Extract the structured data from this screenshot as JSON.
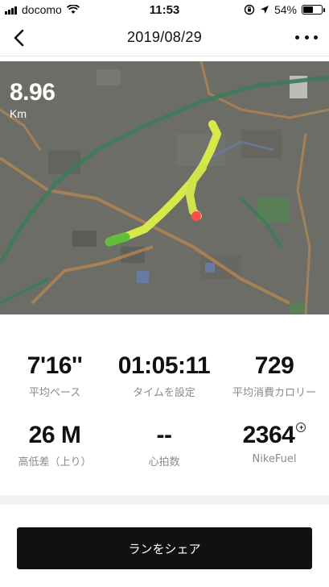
{
  "status_bar": {
    "carrier": "docomo",
    "time": "11:53",
    "battery": "54%",
    "battery_level": 0.54
  },
  "nav": {
    "title": "2019/08/29"
  },
  "map": {
    "distance_value": "8.96",
    "distance_unit": "Km"
  },
  "stats": [
    {
      "value": "7'16''",
      "label": "平均ペース"
    },
    {
      "value": "01:05:11",
      "label": "タイムを設定"
    },
    {
      "value": "729",
      "label": "平均消費カロリー"
    },
    {
      "value": "26 M",
      "label": "高低差（上り）"
    },
    {
      "value": "--",
      "label": "心拍数"
    },
    {
      "value": "2364",
      "label": "NikeFuel"
    }
  ],
  "share_button": {
    "label": "ランをシェア"
  },
  "colors": {
    "accent": "#111111",
    "route_start": "#5fbf3a",
    "route": "#d7e84a",
    "route_end": "#ff4d4d",
    "map_bg": "#6b6b66",
    "label_gray": "#8a8a8a"
  }
}
